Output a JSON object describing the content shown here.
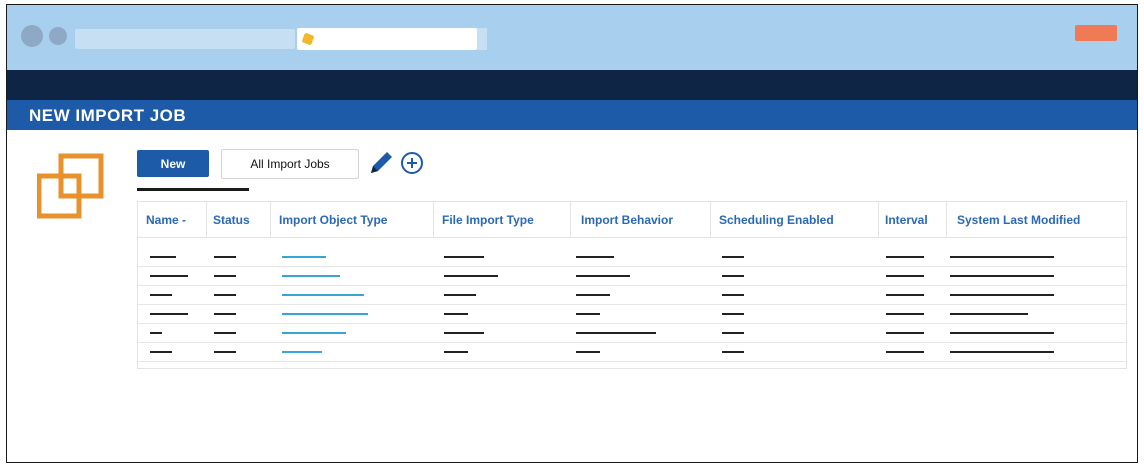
{
  "page": {
    "title": "NEW IMPORT JOB"
  },
  "toolbar": {
    "new_label": "New",
    "all_jobs_label": "All Import Jobs",
    "edit_icon": "pencil-icon",
    "add_icon": "plus-circle-icon"
  },
  "table": {
    "columns": [
      "Name -",
      "Status",
      "Import Object Type",
      "File Import Type",
      "Import Behavior",
      "Scheduling Enabled",
      "Interval",
      "System Last Modified"
    ],
    "row_count": 6
  },
  "colors": {
    "accent": "#1d5aa8",
    "nav_dark": "#0e2545",
    "chrome": "#a9cfee",
    "link": "#35a6d6",
    "logo": "#e8922e",
    "close_button": "#ef7a55"
  }
}
